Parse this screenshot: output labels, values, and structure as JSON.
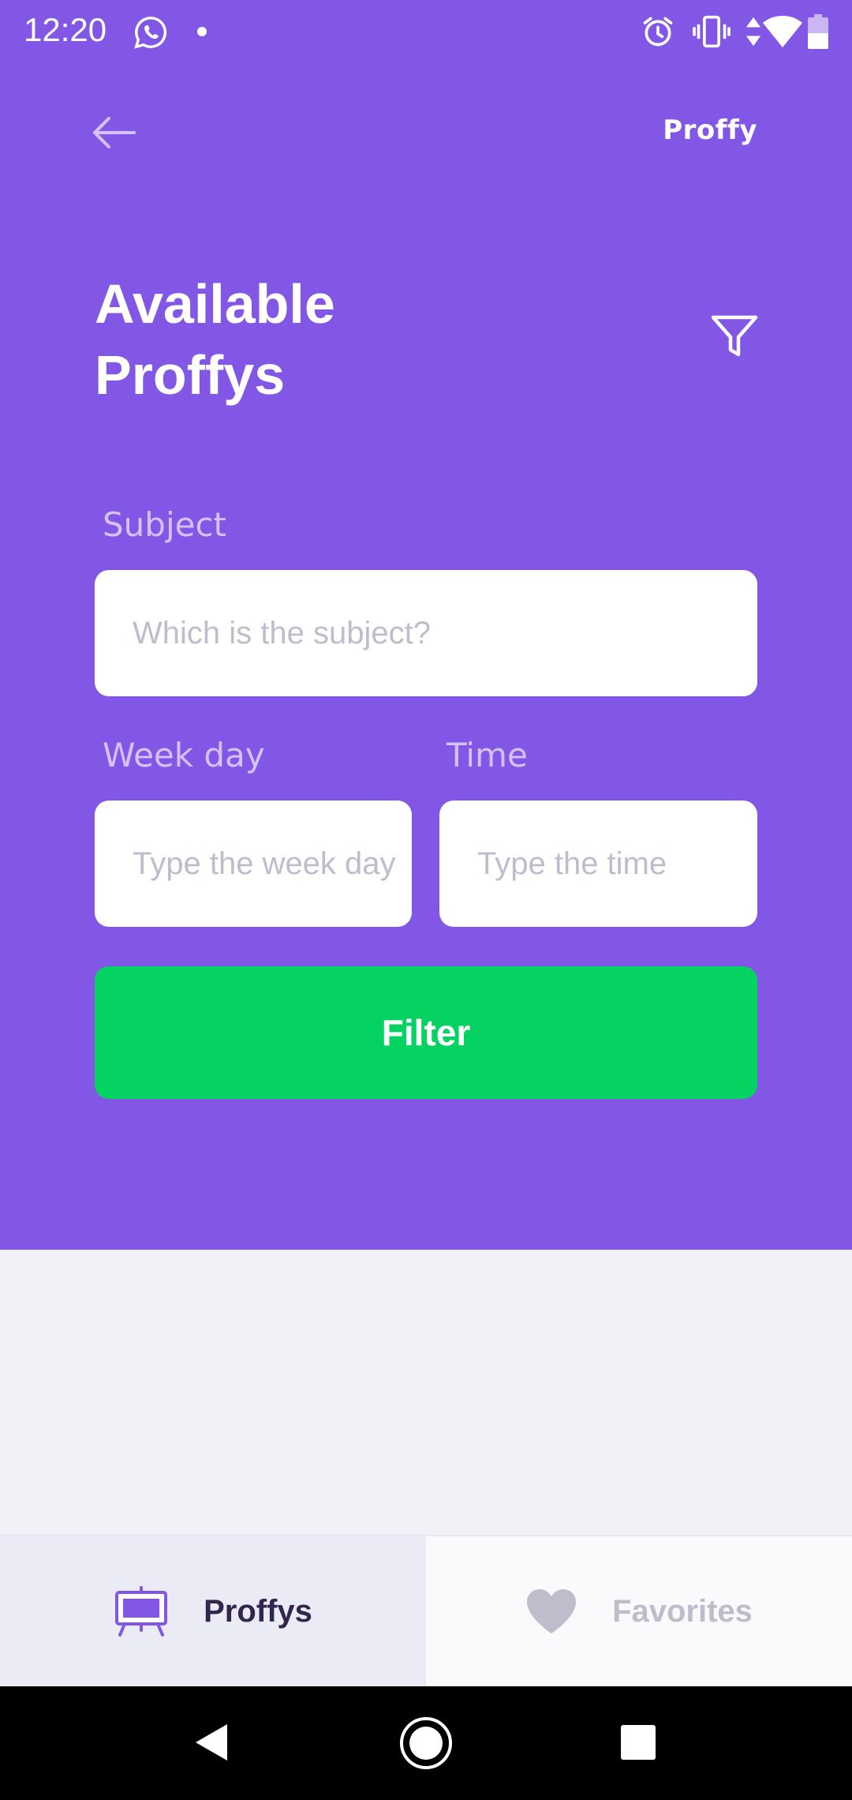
{
  "status_bar": {
    "time": "12:20"
  },
  "header": {
    "logo": "Proffy",
    "title": "Available Proffys"
  },
  "form": {
    "subject_label": "Subject",
    "subject_placeholder": "Which is the subject?",
    "weekday_label": "Week day",
    "weekday_placeholder": "Type the week day",
    "time_label": "Time",
    "time_placeholder": "Type the time",
    "filter_button": "Filter"
  },
  "tabs": [
    {
      "label": "Proffys",
      "icon": "easel-icon",
      "active": true
    },
    {
      "label": "Favorites",
      "icon": "heart-icon",
      "active": false
    }
  ],
  "colors": {
    "primary": "#8257E5",
    "secondary": "#04D361",
    "label": "#D4C2FF",
    "placeholder": "#C1BCCC",
    "background": "#F0F0F7"
  }
}
